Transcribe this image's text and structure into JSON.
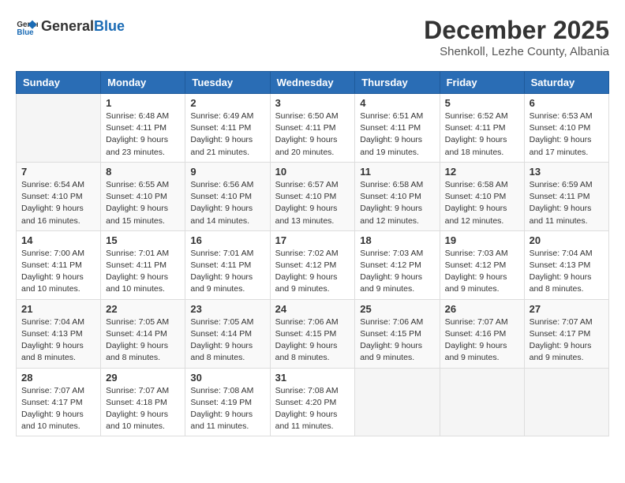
{
  "header": {
    "logo_general": "General",
    "logo_blue": "Blue",
    "title": "December 2025",
    "location": "Shenkoll, Lezhe County, Albania"
  },
  "days_of_week": [
    "Sunday",
    "Monday",
    "Tuesday",
    "Wednesday",
    "Thursday",
    "Friday",
    "Saturday"
  ],
  "weeks": [
    [
      {
        "day": "",
        "info": ""
      },
      {
        "day": "1",
        "info": "Sunrise: 6:48 AM\nSunset: 4:11 PM\nDaylight: 9 hours\nand 23 minutes."
      },
      {
        "day": "2",
        "info": "Sunrise: 6:49 AM\nSunset: 4:11 PM\nDaylight: 9 hours\nand 21 minutes."
      },
      {
        "day": "3",
        "info": "Sunrise: 6:50 AM\nSunset: 4:11 PM\nDaylight: 9 hours\nand 20 minutes."
      },
      {
        "day": "4",
        "info": "Sunrise: 6:51 AM\nSunset: 4:11 PM\nDaylight: 9 hours\nand 19 minutes."
      },
      {
        "day": "5",
        "info": "Sunrise: 6:52 AM\nSunset: 4:11 PM\nDaylight: 9 hours\nand 18 minutes."
      },
      {
        "day": "6",
        "info": "Sunrise: 6:53 AM\nSunset: 4:10 PM\nDaylight: 9 hours\nand 17 minutes."
      }
    ],
    [
      {
        "day": "7",
        "info": "Sunrise: 6:54 AM\nSunset: 4:10 PM\nDaylight: 9 hours\nand 16 minutes."
      },
      {
        "day": "8",
        "info": "Sunrise: 6:55 AM\nSunset: 4:10 PM\nDaylight: 9 hours\nand 15 minutes."
      },
      {
        "day": "9",
        "info": "Sunrise: 6:56 AM\nSunset: 4:10 PM\nDaylight: 9 hours\nand 14 minutes."
      },
      {
        "day": "10",
        "info": "Sunrise: 6:57 AM\nSunset: 4:10 PM\nDaylight: 9 hours\nand 13 minutes."
      },
      {
        "day": "11",
        "info": "Sunrise: 6:58 AM\nSunset: 4:10 PM\nDaylight: 9 hours\nand 12 minutes."
      },
      {
        "day": "12",
        "info": "Sunrise: 6:58 AM\nSunset: 4:10 PM\nDaylight: 9 hours\nand 12 minutes."
      },
      {
        "day": "13",
        "info": "Sunrise: 6:59 AM\nSunset: 4:11 PM\nDaylight: 9 hours\nand 11 minutes."
      }
    ],
    [
      {
        "day": "14",
        "info": "Sunrise: 7:00 AM\nSunset: 4:11 PM\nDaylight: 9 hours\nand 10 minutes."
      },
      {
        "day": "15",
        "info": "Sunrise: 7:01 AM\nSunset: 4:11 PM\nDaylight: 9 hours\nand 10 minutes."
      },
      {
        "day": "16",
        "info": "Sunrise: 7:01 AM\nSunset: 4:11 PM\nDaylight: 9 hours\nand 9 minutes."
      },
      {
        "day": "17",
        "info": "Sunrise: 7:02 AM\nSunset: 4:12 PM\nDaylight: 9 hours\nand 9 minutes."
      },
      {
        "day": "18",
        "info": "Sunrise: 7:03 AM\nSunset: 4:12 PM\nDaylight: 9 hours\nand 9 minutes."
      },
      {
        "day": "19",
        "info": "Sunrise: 7:03 AM\nSunset: 4:12 PM\nDaylight: 9 hours\nand 9 minutes."
      },
      {
        "day": "20",
        "info": "Sunrise: 7:04 AM\nSunset: 4:13 PM\nDaylight: 9 hours\nand 8 minutes."
      }
    ],
    [
      {
        "day": "21",
        "info": "Sunrise: 7:04 AM\nSunset: 4:13 PM\nDaylight: 9 hours\nand 8 minutes."
      },
      {
        "day": "22",
        "info": "Sunrise: 7:05 AM\nSunset: 4:14 PM\nDaylight: 9 hours\nand 8 minutes."
      },
      {
        "day": "23",
        "info": "Sunrise: 7:05 AM\nSunset: 4:14 PM\nDaylight: 9 hours\nand 8 minutes."
      },
      {
        "day": "24",
        "info": "Sunrise: 7:06 AM\nSunset: 4:15 PM\nDaylight: 9 hours\nand 8 minutes."
      },
      {
        "day": "25",
        "info": "Sunrise: 7:06 AM\nSunset: 4:15 PM\nDaylight: 9 hours\nand 9 minutes."
      },
      {
        "day": "26",
        "info": "Sunrise: 7:07 AM\nSunset: 4:16 PM\nDaylight: 9 hours\nand 9 minutes."
      },
      {
        "day": "27",
        "info": "Sunrise: 7:07 AM\nSunset: 4:17 PM\nDaylight: 9 hours\nand 9 minutes."
      }
    ],
    [
      {
        "day": "28",
        "info": "Sunrise: 7:07 AM\nSunset: 4:17 PM\nDaylight: 9 hours\nand 10 minutes."
      },
      {
        "day": "29",
        "info": "Sunrise: 7:07 AM\nSunset: 4:18 PM\nDaylight: 9 hours\nand 10 minutes."
      },
      {
        "day": "30",
        "info": "Sunrise: 7:08 AM\nSunset: 4:19 PM\nDaylight: 9 hours\nand 11 minutes."
      },
      {
        "day": "31",
        "info": "Sunrise: 7:08 AM\nSunset: 4:20 PM\nDaylight: 9 hours\nand 11 minutes."
      },
      {
        "day": "",
        "info": ""
      },
      {
        "day": "",
        "info": ""
      },
      {
        "day": "",
        "info": ""
      }
    ]
  ]
}
